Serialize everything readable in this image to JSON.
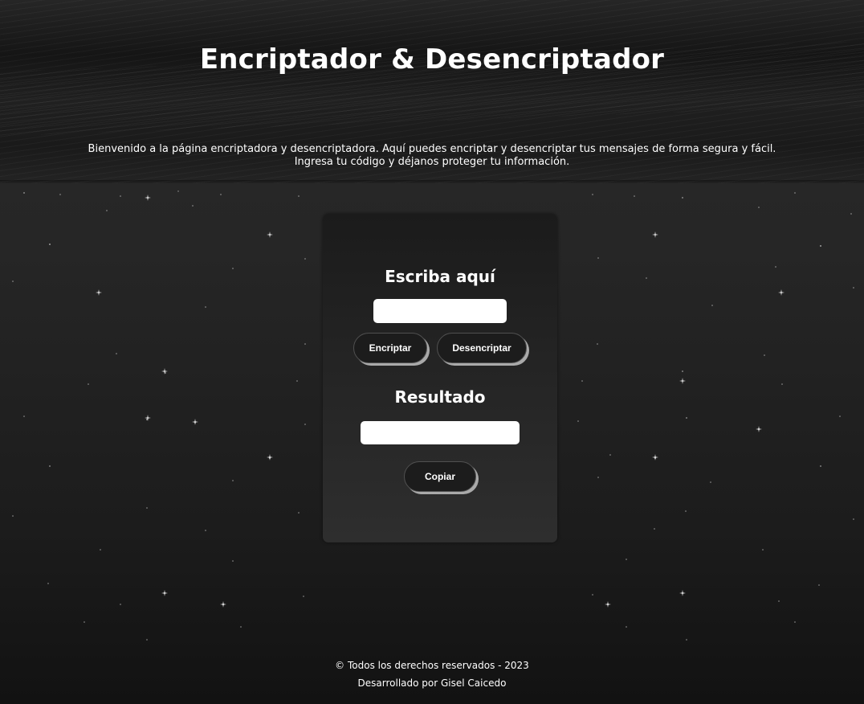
{
  "header": {
    "title": "Encriptador & Desencriptador",
    "intro_line1": "Bienvenido a la página encriptadora y desencriptadora. Aquí puedes encriptar y desencriptar tus mensajes de forma segura y fácil.",
    "intro_line2": "Ingresa tu código y déjanos proteger tu información."
  },
  "card": {
    "input_heading": "Escriba aquí",
    "input_value": "",
    "encrypt_label": "Encriptar",
    "decrypt_label": "Desencriptar",
    "result_heading": "Resultado",
    "result_value": "",
    "copy_label": "Copiar"
  },
  "footer": {
    "copyright": "© Todos los derechos reservados - 2023",
    "credit": "Desarrollado por Gisel Caicedo"
  },
  "colors": {
    "background": "#262626",
    "card": "#242424",
    "button": "#1c1c1c",
    "button_shadow": "#a9a9a9",
    "text": "#ffffff"
  }
}
